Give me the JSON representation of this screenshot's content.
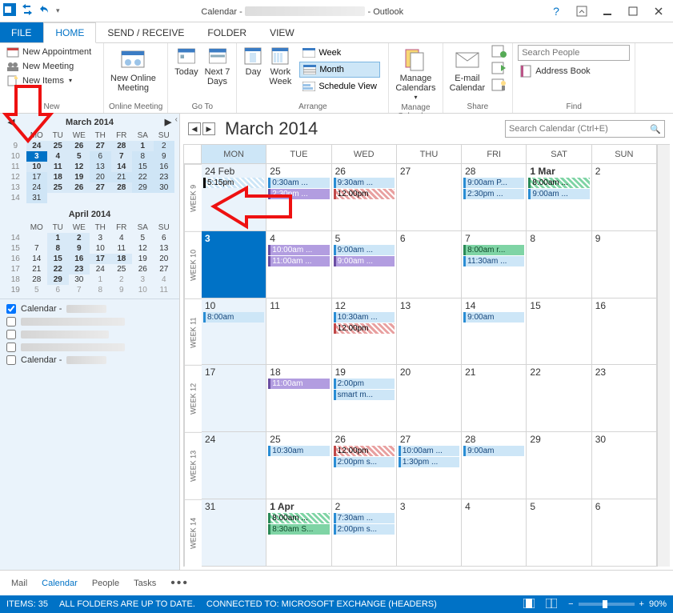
{
  "title": {
    "prefix": "Calendar -",
    "suffix": "- Outlook"
  },
  "tabs": {
    "file": "FILE",
    "home": "HOME",
    "sendrecv": "SEND / RECEIVE",
    "folder": "FOLDER",
    "view": "VIEW"
  },
  "ribbon": {
    "new": {
      "label": "New",
      "appt": "New Appointment",
      "meeting": "New Meeting",
      "items": "New Items"
    },
    "online": {
      "label": "Online Meeting",
      "btn": "New Online\nMeeting"
    },
    "goto": {
      "label": "Go To",
      "today": "Today",
      "next7": "Next 7\nDays"
    },
    "arrange": {
      "label": "Arrange",
      "day": "Day",
      "workweek": "Work\nWeek",
      "week": "Week",
      "month": "Month",
      "schedule": "Schedule View"
    },
    "manage": {
      "label": "Manage\nCalendars",
      "btn": "Manage\nCalendars"
    },
    "share": {
      "label": "Share",
      "btn": "E-mail\nCalendar"
    },
    "find": {
      "label": "Find",
      "search_ph": "Search People",
      "addrbook": "Address Book"
    }
  },
  "mini1": {
    "title": "March 2014",
    "dow": [
      "MO",
      "TU",
      "WE",
      "TH",
      "FR",
      "SA",
      "SU"
    ],
    "rows": [
      {
        "wn": "9",
        "days": [
          {
            "d": "24",
            "c": "bold"
          },
          {
            "d": "25",
            "c": "bold"
          },
          {
            "d": "26",
            "c": "bold"
          },
          {
            "d": "27",
            "c": "bold"
          },
          {
            "d": "28",
            "c": "bold"
          },
          {
            "d": "1",
            "c": "bold"
          },
          {
            "d": "2",
            "c": "range"
          }
        ]
      },
      {
        "wn": "10",
        "days": [
          {
            "d": "3",
            "c": "today"
          },
          {
            "d": "4",
            "c": "bold"
          },
          {
            "d": "5",
            "c": "bold"
          },
          {
            "d": "6",
            "c": "range"
          },
          {
            "d": "7",
            "c": "bold"
          },
          {
            "d": "8",
            "c": "range"
          },
          {
            "d": "9",
            "c": "range"
          }
        ]
      },
      {
        "wn": "11",
        "days": [
          {
            "d": "10",
            "c": "bold"
          },
          {
            "d": "11",
            "c": "bold"
          },
          {
            "d": "12",
            "c": "bold"
          },
          {
            "d": "13",
            "c": "range"
          },
          {
            "d": "14",
            "c": "bold"
          },
          {
            "d": "15",
            "c": "range"
          },
          {
            "d": "16",
            "c": "range"
          }
        ]
      },
      {
        "wn": "12",
        "days": [
          {
            "d": "17",
            "c": "range"
          },
          {
            "d": "18",
            "c": "bold"
          },
          {
            "d": "19",
            "c": "bold"
          },
          {
            "d": "20",
            "c": "range"
          },
          {
            "d": "21",
            "c": "range"
          },
          {
            "d": "22",
            "c": "range"
          },
          {
            "d": "23",
            "c": "range"
          }
        ]
      },
      {
        "wn": "13",
        "days": [
          {
            "d": "24",
            "c": "range"
          },
          {
            "d": "25",
            "c": "bold"
          },
          {
            "d": "26",
            "c": "bold"
          },
          {
            "d": "27",
            "c": "bold"
          },
          {
            "d": "28",
            "c": "bold"
          },
          {
            "d": "29",
            "c": "range"
          },
          {
            "d": "30",
            "c": "range"
          }
        ]
      },
      {
        "wn": "14",
        "days": [
          {
            "d": "31",
            "c": "range"
          },
          {
            "d": "",
            "c": ""
          },
          {
            "d": "",
            "c": ""
          },
          {
            "d": "",
            "c": ""
          },
          {
            "d": "",
            "c": ""
          },
          {
            "d": "",
            "c": ""
          },
          {
            "d": "",
            "c": ""
          }
        ]
      }
    ]
  },
  "mini2": {
    "title": "April 2014",
    "dow": [
      "MO",
      "TU",
      "WE",
      "TH",
      "FR",
      "SA",
      "SU"
    ],
    "rows": [
      {
        "wn": "14",
        "days": [
          {
            "d": "",
            "c": ""
          },
          {
            "d": "1",
            "c": "bold"
          },
          {
            "d": "2",
            "c": "bold"
          },
          {
            "d": "3",
            "c": ""
          },
          {
            "d": "4",
            "c": ""
          },
          {
            "d": "5",
            "c": ""
          },
          {
            "d": "6",
            "c": ""
          }
        ]
      },
      {
        "wn": "15",
        "days": [
          {
            "d": "7",
            "c": ""
          },
          {
            "d": "8",
            "c": "bold"
          },
          {
            "d": "9",
            "c": "bold"
          },
          {
            "d": "10",
            "c": ""
          },
          {
            "d": "11",
            "c": ""
          },
          {
            "d": "12",
            "c": ""
          },
          {
            "d": "13",
            "c": ""
          }
        ]
      },
      {
        "wn": "16",
        "days": [
          {
            "d": "14",
            "c": ""
          },
          {
            "d": "15",
            "c": "bold"
          },
          {
            "d": "16",
            "c": "bold"
          },
          {
            "d": "17",
            "c": "bold"
          },
          {
            "d": "18",
            "c": "bold"
          },
          {
            "d": "19",
            "c": ""
          },
          {
            "d": "20",
            "c": ""
          }
        ]
      },
      {
        "wn": "17",
        "days": [
          {
            "d": "21",
            "c": ""
          },
          {
            "d": "22",
            "c": "bold"
          },
          {
            "d": "23",
            "c": "bold"
          },
          {
            "d": "24",
            "c": ""
          },
          {
            "d": "25",
            "c": ""
          },
          {
            "d": "26",
            "c": ""
          },
          {
            "d": "27",
            "c": ""
          }
        ]
      },
      {
        "wn": "18",
        "days": [
          {
            "d": "28",
            "c": ""
          },
          {
            "d": "29",
            "c": "bold"
          },
          {
            "d": "30",
            "c": ""
          },
          {
            "d": "1",
            "c": "dim"
          },
          {
            "d": "2",
            "c": "dim"
          },
          {
            "d": "3",
            "c": "dim"
          },
          {
            "d": "4",
            "c": "dim"
          }
        ]
      },
      {
        "wn": "19",
        "days": [
          {
            "d": "5",
            "c": "dim"
          },
          {
            "d": "6",
            "c": "dim"
          },
          {
            "d": "7",
            "c": "dim"
          },
          {
            "d": "8",
            "c": "dim"
          },
          {
            "d": "9",
            "c": "dim"
          },
          {
            "d": "10",
            "c": "dim"
          },
          {
            "d": "11",
            "c": "dim"
          }
        ]
      }
    ]
  },
  "cal_list": {
    "main": "Calendar -",
    "alt": "Calendar -"
  },
  "main": {
    "title": "March 2014",
    "search_ph": "Search Calendar (Ctrl+E)",
    "dow": [
      "MON",
      "TUE",
      "WED",
      "THU",
      "FRI",
      "SAT",
      "SUN"
    ],
    "weeks": [
      "WEEK 9",
      "WEEK 10",
      "WEEK 11",
      "WEEK 12",
      "WEEK 13",
      "WEEK 14"
    ],
    "rows": [
      [
        {
          "n": "24 Feb",
          "mon": true,
          "ev": [
            {
              "t": "5:15pm",
              "c": "hatch"
            }
          ]
        },
        {
          "n": "25",
          "ev": [
            {
              "t": "0:30am ...",
              "c": "blue"
            },
            {
              "t": "2:30pm ...",
              "c": "purple"
            }
          ]
        },
        {
          "n": "26",
          "ev": [
            {
              "t": "9:30am ...",
              "c": "blue"
            },
            {
              "t": "12:00pm",
              "c": "hatchred"
            }
          ]
        },
        {
          "n": "27",
          "ev": []
        },
        {
          "n": "28",
          "ev": [
            {
              "t": "9:00am P...",
              "c": "blue"
            },
            {
              "t": "2:30pm ...",
              "c": "blue"
            }
          ]
        },
        {
          "n": "1 Mar",
          "bold": true,
          "ev": [
            {
              "t": "8:00am ...",
              "c": "hatchgreen"
            },
            {
              "t": "9:00am ...",
              "c": "blue"
            }
          ]
        },
        {
          "n": "2",
          "ev": []
        }
      ],
      [
        {
          "n": "3",
          "mon": true,
          "today": true,
          "ev": []
        },
        {
          "n": "4",
          "ev": [
            {
              "t": "10:00am ...",
              "c": "purple"
            },
            {
              "t": "11:00am ...",
              "c": "purple"
            }
          ]
        },
        {
          "n": "5",
          "ev": [
            {
              "t": "9:00am ...",
              "c": "blue"
            },
            {
              "t": "9:00am ...",
              "c": "purple"
            }
          ]
        },
        {
          "n": "6",
          "ev": []
        },
        {
          "n": "7",
          "ev": [
            {
              "t": "8:00am r...",
              "c": "green"
            },
            {
              "t": "11:30am ...",
              "c": "blue"
            }
          ]
        },
        {
          "n": "8",
          "ev": []
        },
        {
          "n": "9",
          "ev": []
        }
      ],
      [
        {
          "n": "10",
          "mon": true,
          "ev": [
            {
              "t": "8:00am",
              "c": "blue"
            }
          ]
        },
        {
          "n": "11",
          "ev": []
        },
        {
          "n": "12",
          "ev": [
            {
              "t": "10:30am ...",
              "c": "blue"
            },
            {
              "t": "12:00pm",
              "c": "hatchred"
            }
          ]
        },
        {
          "n": "13",
          "ev": []
        },
        {
          "n": "14",
          "ev": [
            {
              "t": "9:00am",
              "c": "blue"
            }
          ]
        },
        {
          "n": "15",
          "ev": []
        },
        {
          "n": "16",
          "ev": []
        }
      ],
      [
        {
          "n": "17",
          "mon": true,
          "ev": []
        },
        {
          "n": "18",
          "ev": [
            {
              "t": "11:00am",
              "c": "purple"
            }
          ]
        },
        {
          "n": "19",
          "ev": [
            {
              "t": "2:00pm",
              "c": "blue"
            },
            {
              "t": "smart m...",
              "c": "blue"
            }
          ]
        },
        {
          "n": "20",
          "ev": []
        },
        {
          "n": "21",
          "ev": []
        },
        {
          "n": "22",
          "ev": []
        },
        {
          "n": "23",
          "ev": []
        }
      ],
      [
        {
          "n": "24",
          "mon": true,
          "ev": []
        },
        {
          "n": "25",
          "ev": [
            {
              "t": "10:30am",
              "c": "blue"
            }
          ]
        },
        {
          "n": "26",
          "ev": [
            {
              "t": "12:00pm",
              "c": "hatchred"
            },
            {
              "t": "2:00pm s...",
              "c": "blue"
            }
          ]
        },
        {
          "n": "27",
          "ev": [
            {
              "t": "10:00am ...",
              "c": "blue"
            },
            {
              "t": "1:30pm ...",
              "c": "blue"
            }
          ]
        },
        {
          "n": "28",
          "ev": [
            {
              "t": "9:00am",
              "c": "blue"
            }
          ]
        },
        {
          "n": "29",
          "ev": []
        },
        {
          "n": "30",
          "ev": []
        }
      ],
      [
        {
          "n": "31",
          "mon": true,
          "ev": []
        },
        {
          "n": "1 Apr",
          "bold": true,
          "ev": [
            {
              "t": "8:00am ...",
              "c": "hatchgreen"
            },
            {
              "t": "8:30am S...",
              "c": "green"
            }
          ]
        },
        {
          "n": "2",
          "ev": [
            {
              "t": "7:30am ...",
              "c": "blue"
            },
            {
              "t": "2:00pm s...",
              "c": "blue"
            }
          ]
        },
        {
          "n": "3",
          "ev": []
        },
        {
          "n": "4",
          "ev": []
        },
        {
          "n": "5",
          "ev": []
        },
        {
          "n": "6",
          "ev": []
        }
      ]
    ]
  },
  "nav": {
    "mail": "Mail",
    "calendar": "Calendar",
    "people": "People",
    "tasks": "Tasks"
  },
  "status": {
    "items": "ITEMS: 35",
    "folders": "ALL FOLDERS ARE UP TO DATE.",
    "conn": "CONNECTED TO: MICROSOFT EXCHANGE (HEADERS)",
    "zoom": "90%"
  }
}
